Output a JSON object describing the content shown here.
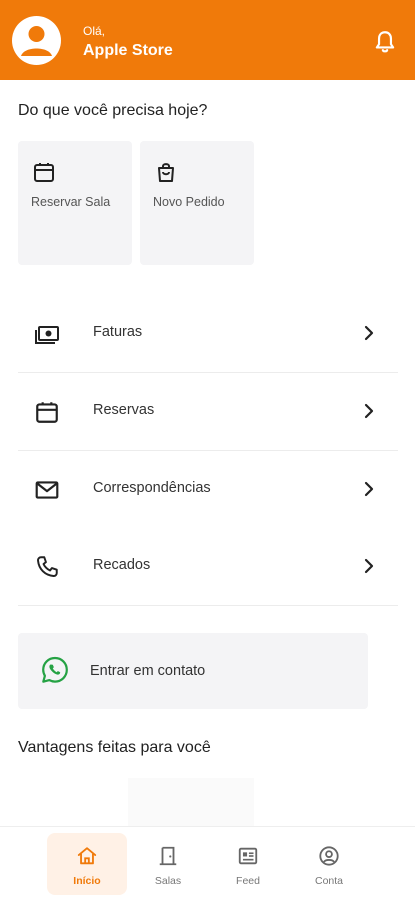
{
  "colors": {
    "accent": "#F07A0A",
    "card_bg": "#F4F4F6",
    "whatsapp": "#25A244"
  },
  "header": {
    "greeting": "Olá,",
    "name": "Apple Store",
    "avatar_icon": "user-icon",
    "bell_icon": "bell-icon"
  },
  "quick_actions": {
    "title": "Do que você precisa hoje?",
    "items": [
      {
        "label": "Reservar Sala",
        "icon": "calendar-icon"
      },
      {
        "label": "Novo Pedido",
        "icon": "shopping-bag-icon"
      }
    ]
  },
  "menu": [
    {
      "label": "Faturas",
      "icon": "money-icon"
    },
    {
      "label": "Reservas",
      "icon": "calendar-icon"
    },
    {
      "label": "Correspondências",
      "icon": "mail-icon"
    },
    {
      "label": "Recados",
      "icon": "phone-icon"
    }
  ],
  "contact": {
    "label": "Entrar em contato",
    "icon": "whatsapp-icon"
  },
  "benefits": {
    "title": "Vantagens feitas para você"
  },
  "bottom_nav": [
    {
      "label": "Início",
      "icon": "home-icon",
      "active": true
    },
    {
      "label": "Salas",
      "icon": "door-icon",
      "active": false
    },
    {
      "label": "Feed",
      "icon": "news-icon",
      "active": false
    },
    {
      "label": "Conta",
      "icon": "account-icon",
      "active": false
    }
  ]
}
